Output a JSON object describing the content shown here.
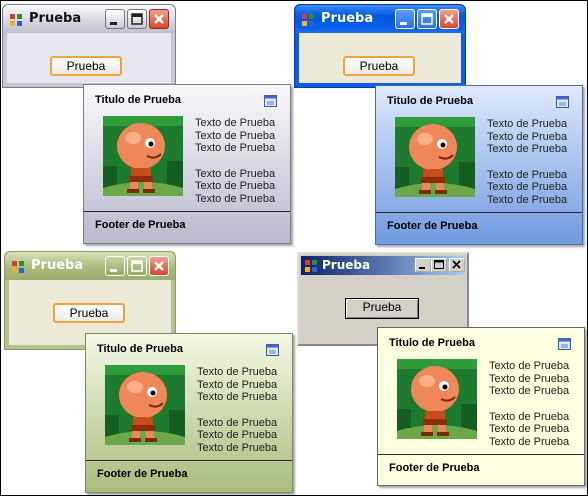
{
  "quadrants": [
    {
      "theme": "silver",
      "window": {
        "title": "Prueba",
        "button_label": "Prueba"
      },
      "popup": {
        "title": "Titulo de Prueba",
        "lines": [
          "Texto de Prueba",
          "Texto de Prueba",
          "Texto de Prueba",
          "",
          "Texto de Prueba",
          "Texto de Prueba",
          "Texto de Prueba"
        ],
        "footer": "Footer de Prueba"
      }
    },
    {
      "theme": "blue",
      "window": {
        "title": "Prueba",
        "button_label": "Prueba"
      },
      "popup": {
        "title": "Titulo de Prueba",
        "lines": [
          "Texto de Prueba",
          "Texto de Prueba",
          "Texto de Prueba",
          "",
          "Texto de Prueba",
          "Texto de Prueba",
          "Texto de Prueba"
        ],
        "footer": "Footer de Prueba"
      }
    },
    {
      "theme": "olive",
      "window": {
        "title": "Prueba",
        "button_label": "Prueba"
      },
      "popup": {
        "title": "Titulo de Prueba",
        "lines": [
          "Texto de Prueba",
          "Texto de Prueba",
          "Texto de Prueba",
          "",
          "Texto de Prueba",
          "Texto de Prueba",
          "Texto de Prueba"
        ],
        "footer": "Footer de Prueba"
      }
    },
    {
      "theme": "classic",
      "window": {
        "title": "Prueba",
        "button_label": "Prueba"
      },
      "popup": {
        "title": "Titulo de Prueba",
        "lines": [
          "Texto de Prueba",
          "Texto de Prueba",
          "Texto de Prueba",
          "",
          "Texto de Prueba",
          "Texto de Prueba",
          "Texto de Prueba"
        ],
        "footer": "Footer de Prueba"
      }
    }
  ],
  "icons": {
    "window_icon": "app-window-icon",
    "popup_icon": "popup-app-icon",
    "picture": "character-sprite-picture"
  },
  "colors": {
    "blue_title": "#0a5fe6",
    "olive_title": "#a9bb7d",
    "silver_title": "#d9d9e3",
    "classic_title": "#0a246a",
    "close_red": "#d9472b",
    "classic_face": "#d4d0c8"
  }
}
